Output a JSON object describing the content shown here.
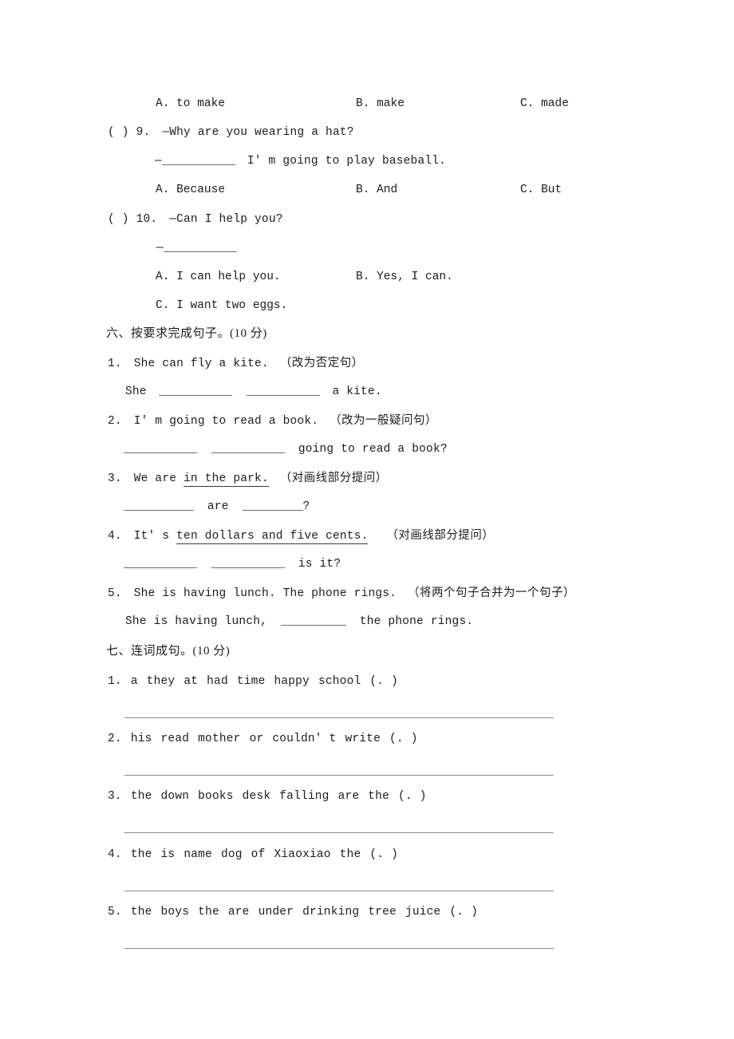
{
  "document": {
    "type": "english-exam-worksheet",
    "page_background": "#ffffff",
    "text_color": "#1c1c1c",
    "rule_color": "#8a8a8a"
  },
  "choice_section": {
    "q8_options": {
      "a": "A. to make",
      "b": "B. make",
      "c": "C. made"
    },
    "q9": {
      "marker": "(   ) 9.",
      "prompt": "—Why are you wearing a hat?",
      "answer_dash": "—",
      "answer_tail": "I' m going to play baseball.",
      "options": {
        "a": "A. Because",
        "b": "B. And",
        "c": "C. But"
      }
    },
    "q10": {
      "marker": "(   ) 10.",
      "prompt": "—Can I help you?",
      "answer_dash": "—",
      "options": {
        "a": "A. I can help you.",
        "b": "B. Yes, I can.",
        "c": "C. I want two eggs."
      }
    }
  },
  "section_six": {
    "heading": "六、按要求完成句子。(10 分)",
    "items": [
      {
        "number": "1.",
        "sentence": "She can fly a kite.",
        "instruction": "（改为否定句）",
        "answer_prefix": "She",
        "answer_suffix": "a kite."
      },
      {
        "number": "2.",
        "sentence": "I' m going to read a book.",
        "instruction": "（改为一般疑问句）",
        "answer_prefix": "",
        "answer_suffix": "going to read a book?"
      },
      {
        "number": "3.",
        "sentence_pre": "We are ",
        "underlined": "in the park.",
        "instruction": "（对画线部分提问）",
        "answer_mid": "are",
        "answer_suffix": "?"
      },
      {
        "number": "4.",
        "sentence_pre": "It' s ",
        "underlined": "ten dollars and five cents.",
        "instruction": "（对画线部分提问）",
        "answer_suffix": "is it?"
      },
      {
        "number": "5.",
        "sentence": "She is having lunch. The phone rings.",
        "instruction": "（将两个句子合并为一个句子）",
        "answer_prefix": "She is having lunch,",
        "answer_suffix": "the phone rings."
      }
    ]
  },
  "section_seven": {
    "heading": "七、连词成句。(10 分)",
    "items": [
      {
        "number": "1.",
        "words": [
          "a",
          "they",
          "at",
          "had",
          "time",
          "happy",
          "school",
          "(. )"
        ]
      },
      {
        "number": "2.",
        "words": [
          "his",
          "read",
          "mother",
          "or",
          "couldn' t",
          "write",
          "(. )"
        ]
      },
      {
        "number": "3.",
        "words": [
          "the",
          "down",
          "books",
          "desk",
          "falling",
          "are",
          "the",
          "(. )"
        ]
      },
      {
        "number": "4.",
        "words": [
          "the",
          "is",
          "name",
          "dog",
          "of",
          "Xiaoxiao",
          "the",
          "(. )"
        ]
      },
      {
        "number": "5.",
        "words": [
          "the",
          "boys",
          "the",
          "are",
          "under",
          "drinking",
          "tree",
          "juice",
          "(. )"
        ]
      }
    ]
  }
}
